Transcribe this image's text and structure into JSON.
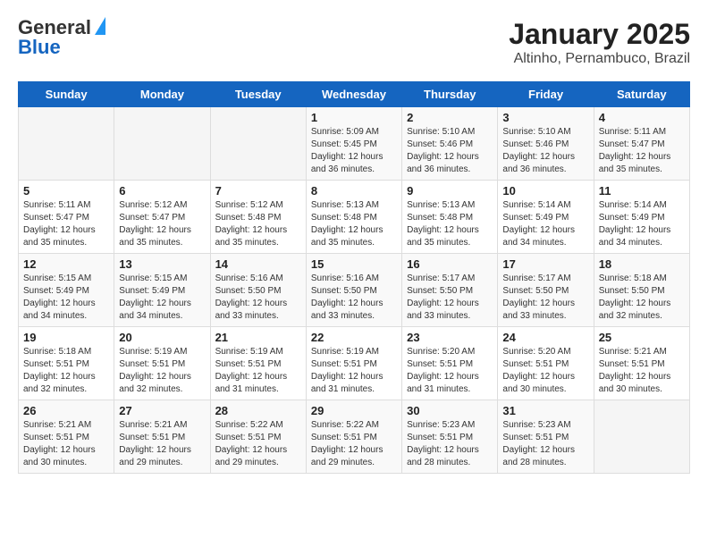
{
  "header": {
    "logo_general": "General",
    "logo_blue": "Blue",
    "month": "January 2025",
    "location": "Altinho, Pernambuco, Brazil"
  },
  "weekdays": [
    "Sunday",
    "Monday",
    "Tuesday",
    "Wednesday",
    "Thursday",
    "Friday",
    "Saturday"
  ],
  "weeks": [
    [
      {
        "day": "",
        "info": ""
      },
      {
        "day": "",
        "info": ""
      },
      {
        "day": "",
        "info": ""
      },
      {
        "day": "1",
        "info": "Sunrise: 5:09 AM\nSunset: 5:45 PM\nDaylight: 12 hours\nand 36 minutes."
      },
      {
        "day": "2",
        "info": "Sunrise: 5:10 AM\nSunset: 5:46 PM\nDaylight: 12 hours\nand 36 minutes."
      },
      {
        "day": "3",
        "info": "Sunrise: 5:10 AM\nSunset: 5:46 PM\nDaylight: 12 hours\nand 36 minutes."
      },
      {
        "day": "4",
        "info": "Sunrise: 5:11 AM\nSunset: 5:47 PM\nDaylight: 12 hours\nand 35 minutes."
      }
    ],
    [
      {
        "day": "5",
        "info": "Sunrise: 5:11 AM\nSunset: 5:47 PM\nDaylight: 12 hours\nand 35 minutes."
      },
      {
        "day": "6",
        "info": "Sunrise: 5:12 AM\nSunset: 5:47 PM\nDaylight: 12 hours\nand 35 minutes."
      },
      {
        "day": "7",
        "info": "Sunrise: 5:12 AM\nSunset: 5:48 PM\nDaylight: 12 hours\nand 35 minutes."
      },
      {
        "day": "8",
        "info": "Sunrise: 5:13 AM\nSunset: 5:48 PM\nDaylight: 12 hours\nand 35 minutes."
      },
      {
        "day": "9",
        "info": "Sunrise: 5:13 AM\nSunset: 5:48 PM\nDaylight: 12 hours\nand 35 minutes."
      },
      {
        "day": "10",
        "info": "Sunrise: 5:14 AM\nSunset: 5:49 PM\nDaylight: 12 hours\nand 34 minutes."
      },
      {
        "day": "11",
        "info": "Sunrise: 5:14 AM\nSunset: 5:49 PM\nDaylight: 12 hours\nand 34 minutes."
      }
    ],
    [
      {
        "day": "12",
        "info": "Sunrise: 5:15 AM\nSunset: 5:49 PM\nDaylight: 12 hours\nand 34 minutes."
      },
      {
        "day": "13",
        "info": "Sunrise: 5:15 AM\nSunset: 5:49 PM\nDaylight: 12 hours\nand 34 minutes."
      },
      {
        "day": "14",
        "info": "Sunrise: 5:16 AM\nSunset: 5:50 PM\nDaylight: 12 hours\nand 33 minutes."
      },
      {
        "day": "15",
        "info": "Sunrise: 5:16 AM\nSunset: 5:50 PM\nDaylight: 12 hours\nand 33 minutes."
      },
      {
        "day": "16",
        "info": "Sunrise: 5:17 AM\nSunset: 5:50 PM\nDaylight: 12 hours\nand 33 minutes."
      },
      {
        "day": "17",
        "info": "Sunrise: 5:17 AM\nSunset: 5:50 PM\nDaylight: 12 hours\nand 33 minutes."
      },
      {
        "day": "18",
        "info": "Sunrise: 5:18 AM\nSunset: 5:50 PM\nDaylight: 12 hours\nand 32 minutes."
      }
    ],
    [
      {
        "day": "19",
        "info": "Sunrise: 5:18 AM\nSunset: 5:51 PM\nDaylight: 12 hours\nand 32 minutes."
      },
      {
        "day": "20",
        "info": "Sunrise: 5:19 AM\nSunset: 5:51 PM\nDaylight: 12 hours\nand 32 minutes."
      },
      {
        "day": "21",
        "info": "Sunrise: 5:19 AM\nSunset: 5:51 PM\nDaylight: 12 hours\nand 31 minutes."
      },
      {
        "day": "22",
        "info": "Sunrise: 5:19 AM\nSunset: 5:51 PM\nDaylight: 12 hours\nand 31 minutes."
      },
      {
        "day": "23",
        "info": "Sunrise: 5:20 AM\nSunset: 5:51 PM\nDaylight: 12 hours\nand 31 minutes."
      },
      {
        "day": "24",
        "info": "Sunrise: 5:20 AM\nSunset: 5:51 PM\nDaylight: 12 hours\nand 30 minutes."
      },
      {
        "day": "25",
        "info": "Sunrise: 5:21 AM\nSunset: 5:51 PM\nDaylight: 12 hours\nand 30 minutes."
      }
    ],
    [
      {
        "day": "26",
        "info": "Sunrise: 5:21 AM\nSunset: 5:51 PM\nDaylight: 12 hours\nand 30 minutes."
      },
      {
        "day": "27",
        "info": "Sunrise: 5:21 AM\nSunset: 5:51 PM\nDaylight: 12 hours\nand 29 minutes."
      },
      {
        "day": "28",
        "info": "Sunrise: 5:22 AM\nSunset: 5:51 PM\nDaylight: 12 hours\nand 29 minutes."
      },
      {
        "day": "29",
        "info": "Sunrise: 5:22 AM\nSunset: 5:51 PM\nDaylight: 12 hours\nand 29 minutes."
      },
      {
        "day": "30",
        "info": "Sunrise: 5:23 AM\nSunset: 5:51 PM\nDaylight: 12 hours\nand 28 minutes."
      },
      {
        "day": "31",
        "info": "Sunrise: 5:23 AM\nSunset: 5:51 PM\nDaylight: 12 hours\nand 28 minutes."
      },
      {
        "day": "",
        "info": ""
      }
    ]
  ]
}
